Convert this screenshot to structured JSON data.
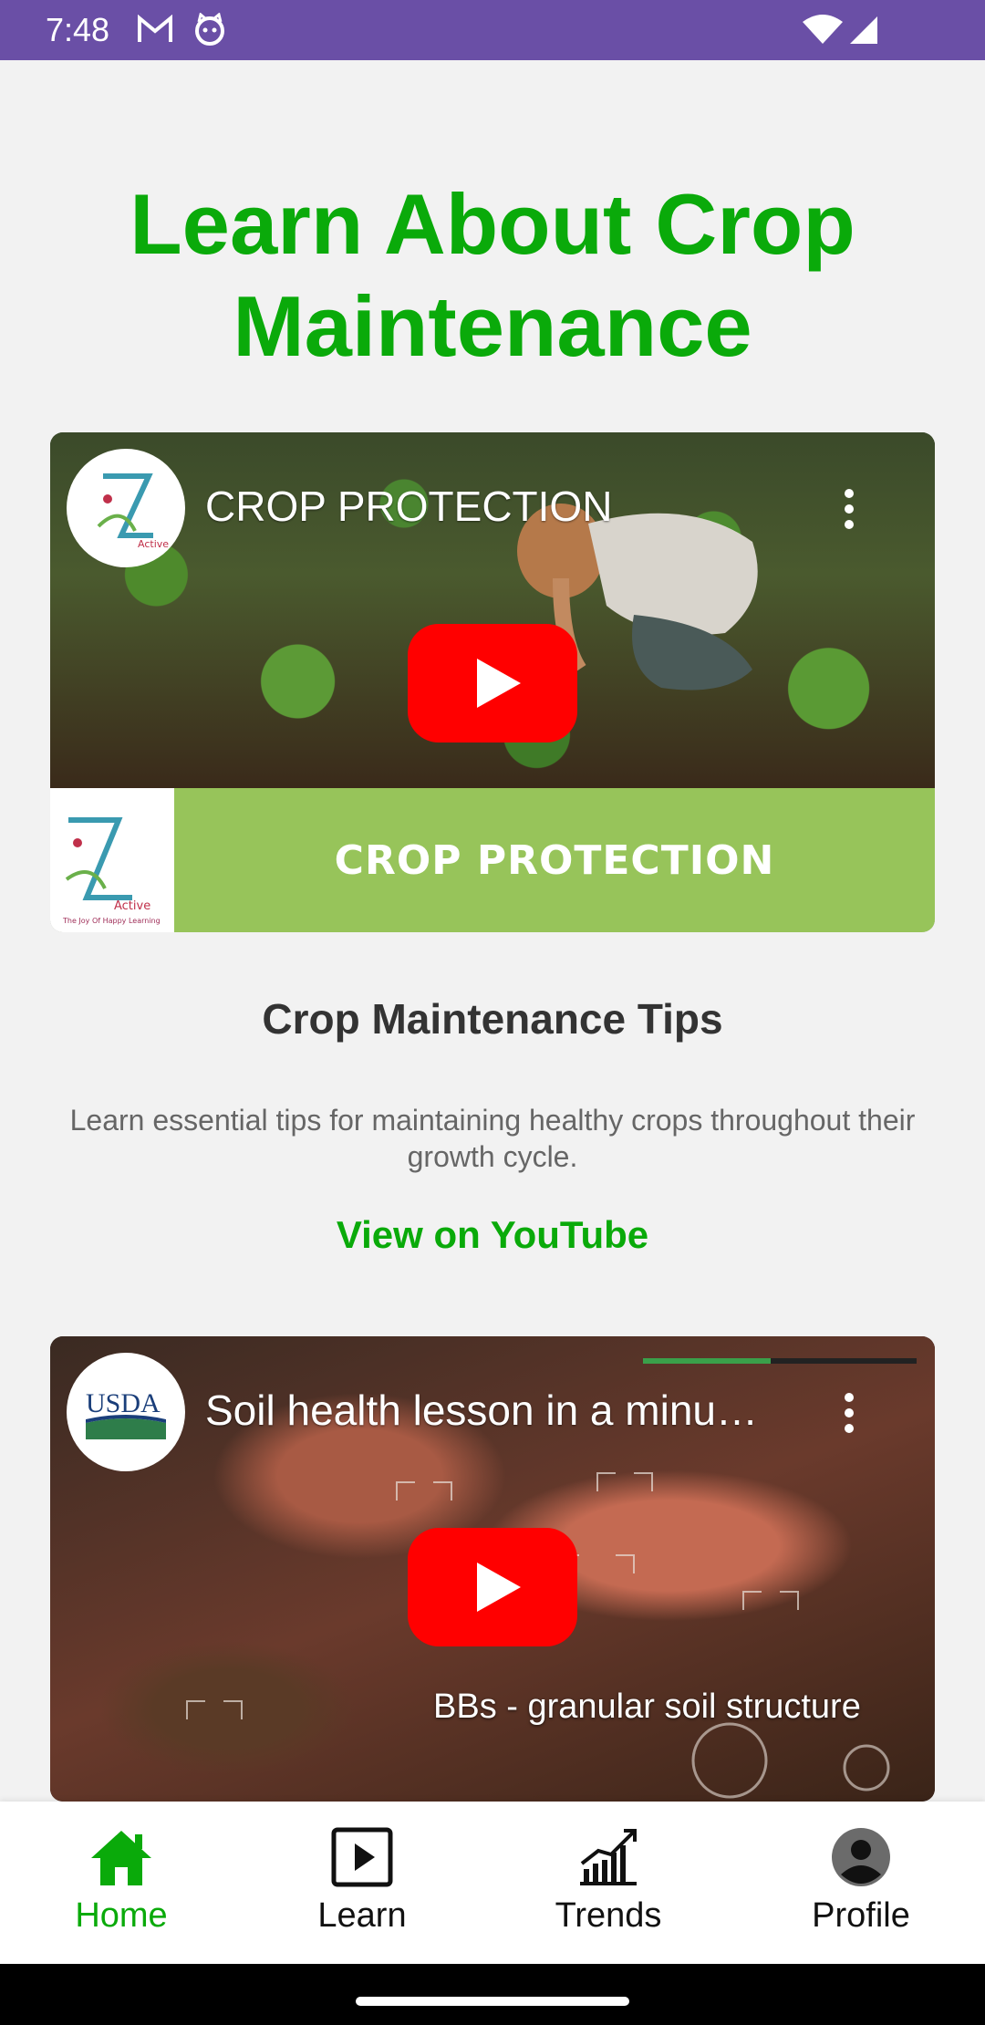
{
  "status_bar": {
    "time": "7:48",
    "icons": [
      "gmail-icon",
      "cat-icon",
      "wifi-icon",
      "signal-icon"
    ]
  },
  "page": {
    "title": "Learn About Crop Maintenance"
  },
  "videos": [
    {
      "title": "CROP PROTECTION",
      "banner_text": "CROP PROTECTION",
      "channel_logo_text": "Active",
      "channel_tagline": "The Joy Of Happy Learning"
    },
    {
      "title": "Soil health lesson in a minu…",
      "caption": "BBs - granular soil structure",
      "channel_logo_text": "USDA"
    }
  ],
  "tips": {
    "title": "Crop Maintenance Tips",
    "description": "Learn essential tips for maintaining healthy crops throughout their growth cycle.",
    "link_label": "View on YouTube"
  },
  "bottom_nav": {
    "items": [
      {
        "label": "Home",
        "icon": "home-icon",
        "active": true
      },
      {
        "label": "Learn",
        "icon": "play-square-icon",
        "active": false
      },
      {
        "label": "Trends",
        "icon": "chart-icon",
        "active": false
      },
      {
        "label": "Profile",
        "icon": "user-icon",
        "active": false
      }
    ]
  },
  "colors": {
    "status_bar": "#6a4fa6",
    "accent_green": "#0aaa0a",
    "banner_green": "#97c45a",
    "youtube_red": "#ff0000"
  }
}
